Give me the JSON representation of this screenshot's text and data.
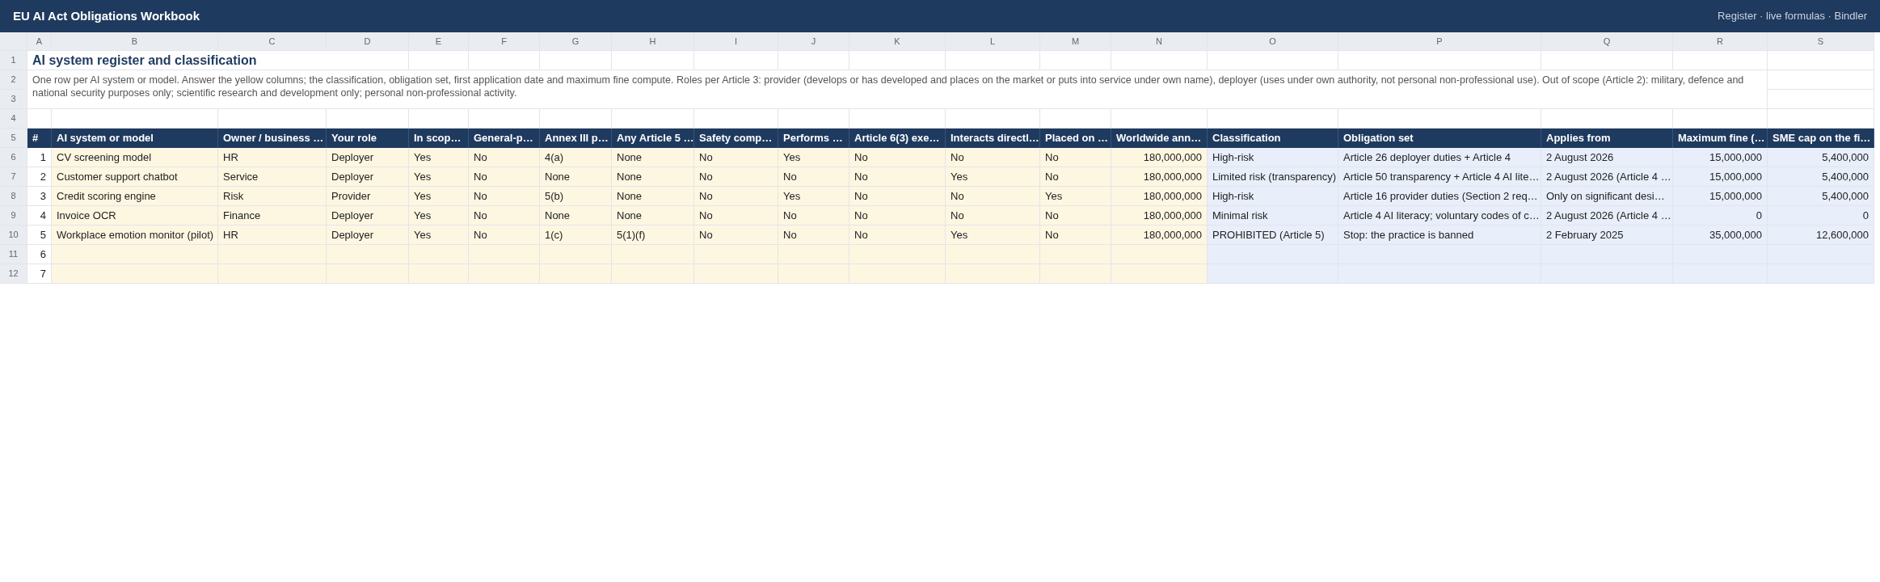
{
  "window": {
    "title": "EU AI Act Obligations Workbook",
    "subtitle": "Register · live formulas · Bindler"
  },
  "sheet": {
    "title_row": "1",
    "title": "AI system register and classification",
    "description_rows": [
      "2",
      "3"
    ],
    "description": "One row per AI system or model. Answer the yellow columns; the classification, obligation set, first application date and maximum fine compute. Roles per Article 3: provider (develops or has developed and places on the market or puts into service under own name), deployer (uses under own authority, not personal non-professional use). Out of scope (Article 2): military, defence and national security purposes only; scientific research and development only; personal non-professional activity.",
    "blank_row": "4",
    "heading_row": "5",
    "columns": [
      {
        "letter": "A",
        "heading": "#",
        "kind": "index",
        "numeric": true
      },
      {
        "letter": "B",
        "heading": "AI system or model",
        "kind": "input",
        "numeric": false
      },
      {
        "letter": "C",
        "heading": "Owner / business …",
        "kind": "input",
        "numeric": false
      },
      {
        "letter": "D",
        "heading": "Your role",
        "kind": "input",
        "numeric": false
      },
      {
        "letter": "E",
        "heading": "In scop…",
        "kind": "input",
        "numeric": false
      },
      {
        "letter": "F",
        "heading": "General-p…",
        "kind": "input",
        "numeric": false
      },
      {
        "letter": "G",
        "heading": "Annex III p…",
        "kind": "input",
        "numeric": false
      },
      {
        "letter": "H",
        "heading": "Any Article 5 …",
        "kind": "input",
        "numeric": false
      },
      {
        "letter": "I",
        "heading": "Safety comp…",
        "kind": "input",
        "numeric": false
      },
      {
        "letter": "J",
        "heading": "Performs …",
        "kind": "input",
        "numeric": false
      },
      {
        "letter": "K",
        "heading": "Article 6(3) exe…",
        "kind": "input",
        "numeric": false
      },
      {
        "letter": "L",
        "heading": "Interacts directl…",
        "kind": "input",
        "numeric": false
      },
      {
        "letter": "M",
        "heading": "Placed on …",
        "kind": "input",
        "numeric": false
      },
      {
        "letter": "N",
        "heading": "Worldwide ann…",
        "kind": "input",
        "numeric": true
      },
      {
        "letter": "O",
        "heading": "Classification",
        "kind": "computed",
        "numeric": false
      },
      {
        "letter": "P",
        "heading": "Obligation set",
        "kind": "computed",
        "numeric": false
      },
      {
        "letter": "Q",
        "heading": "Applies from",
        "kind": "computed",
        "numeric": false
      },
      {
        "letter": "R",
        "heading": "Maximum fine (…",
        "kind": "computed",
        "numeric": true
      },
      {
        "letter": "S",
        "heading": "SME cap on the fi…",
        "kind": "computed",
        "numeric": true
      }
    ],
    "rows": [
      {
        "row_number": "6",
        "cells": [
          "1",
          "CV screening model",
          "HR",
          "Deployer",
          "Yes",
          "No",
          "4(a)",
          "None",
          "No",
          "Yes",
          "No",
          "No",
          "No",
          "180,000,000",
          "High-risk",
          "Article 26 deployer duties + Article 4",
          "2 August 2026",
          "15,000,000",
          "5,400,000"
        ]
      },
      {
        "row_number": "7",
        "cells": [
          "2",
          "Customer support chatbot",
          "Service",
          "Deployer",
          "Yes",
          "No",
          "None",
          "None",
          "No",
          "No",
          "No",
          "Yes",
          "No",
          "180,000,000",
          "Limited risk (transparency)",
          "Article 50 transparency + Article 4 AI lite…",
          "2 August 2026 (Article 4 …",
          "15,000,000",
          "5,400,000"
        ]
      },
      {
        "row_number": "8",
        "cells": [
          "3",
          "Credit scoring engine",
          "Risk",
          "Provider",
          "Yes",
          "No",
          "5(b)",
          "None",
          "No",
          "Yes",
          "No",
          "No",
          "Yes",
          "180,000,000",
          "High-risk",
          "Article 16 provider duties (Section 2 req…",
          "Only on significant desi…",
          "15,000,000",
          "5,400,000"
        ]
      },
      {
        "row_number": "9",
        "cells": [
          "4",
          "Invoice OCR",
          "Finance",
          "Deployer",
          "Yes",
          "No",
          "None",
          "None",
          "No",
          "No",
          "No",
          "No",
          "No",
          "180,000,000",
          "Minimal risk",
          "Article 4 AI literacy; voluntary codes of c…",
          "2 August 2026 (Article 4 …",
          "0",
          "0"
        ]
      },
      {
        "row_number": "10",
        "cells": [
          "5",
          "Workplace emotion monitor (pilot)",
          "HR",
          "Deployer",
          "Yes",
          "No",
          "1(c)",
          "5(1)(f)",
          "No",
          "No",
          "No",
          "Yes",
          "No",
          "180,000,000",
          "PROHIBITED (Article 5)",
          "Stop: the practice is banned",
          "2 February 2025",
          "35,000,000",
          "12,600,000"
        ]
      },
      {
        "row_number": "11",
        "cells": [
          "6"
        ]
      },
      {
        "row_number": "12",
        "cells": [
          "7"
        ]
      }
    ]
  }
}
